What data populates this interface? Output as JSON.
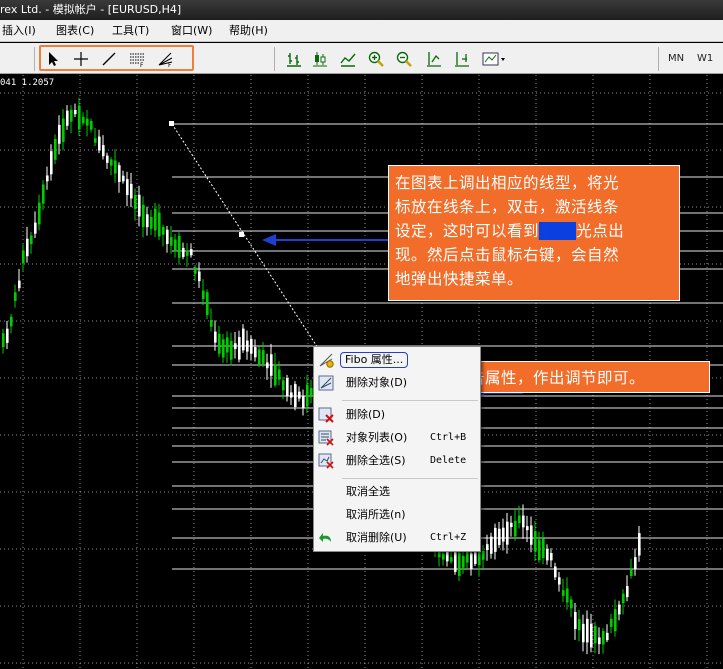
{
  "window": {
    "title": "rex Ltd. - 模拟帐户 - [EURUSD,H4]"
  },
  "menu": {
    "items": [
      "插入(I)",
      "图表(C)",
      "工具(T)",
      "窗口(W)",
      "帮助(H)"
    ]
  },
  "toolbar": {
    "drawing_tools": [
      "cursor-arrow-icon",
      "crosshair-icon",
      "trendline-icon",
      "fibo-lines-icon",
      "fibo-fan-icon"
    ],
    "chart_tools": [
      "bar-chart-icon",
      "candlestick-icon",
      "line-chart-icon",
      "zoom-in-icon",
      "zoom-out-icon",
      "chart-shift-icon",
      "autoscroll-icon",
      "template-icon"
    ],
    "timeframes": [
      "MN",
      "W1"
    ],
    "highlight_color": "#f07d3a"
  },
  "chart": {
    "symbol": "EURUSD",
    "timeframe": "H4",
    "price_info": "041 1.2057",
    "background": "#000000",
    "candle_bull": "#00cc00",
    "candle_bear": "#ffffff",
    "grid_color": "#ffffff"
  },
  "callouts": {
    "main_text_1": "在图表上调出相应的线型，将光",
    "main_text_2": "标放在线条上，双击，激活线条",
    "main_text_3a": "设定，这时可以看到",
    "main_text_3_hidden": "▇▇▇",
    "main_text_3b": "光点出",
    "main_text_4": "现。然后点击鼠标右键，会自然",
    "main_text_5": "地弹出快捷菜单。",
    "side_text": "点击属性，作出调节即可。",
    "color": "#f26c2a",
    "arrow_color": "#1f3fd1"
  },
  "context_menu": {
    "items": [
      {
        "label": "Fibo 属性...",
        "shortcut": "",
        "icon": "fibo-properties-icon"
      },
      {
        "label": "删除对象(D)",
        "shortcut": "",
        "icon": "delete-object-icon"
      },
      {
        "label": "删除(D)",
        "shortcut": "",
        "icon": "delete-icon"
      },
      {
        "label": "对象列表(O)",
        "shortcut": "Ctrl+B",
        "icon": "object-list-icon"
      },
      {
        "label": "删除全选(S)",
        "shortcut": "Delete",
        "icon": "delete-selected-icon"
      },
      {
        "label": "取消全选",
        "shortcut": "",
        "icon": ""
      },
      {
        "label": "取消所选(n)",
        "shortcut": "",
        "icon": ""
      },
      {
        "label": "取消删除(U)",
        "shortcut": "Ctrl+Z",
        "icon": "undo-delete-icon"
      }
    ]
  }
}
